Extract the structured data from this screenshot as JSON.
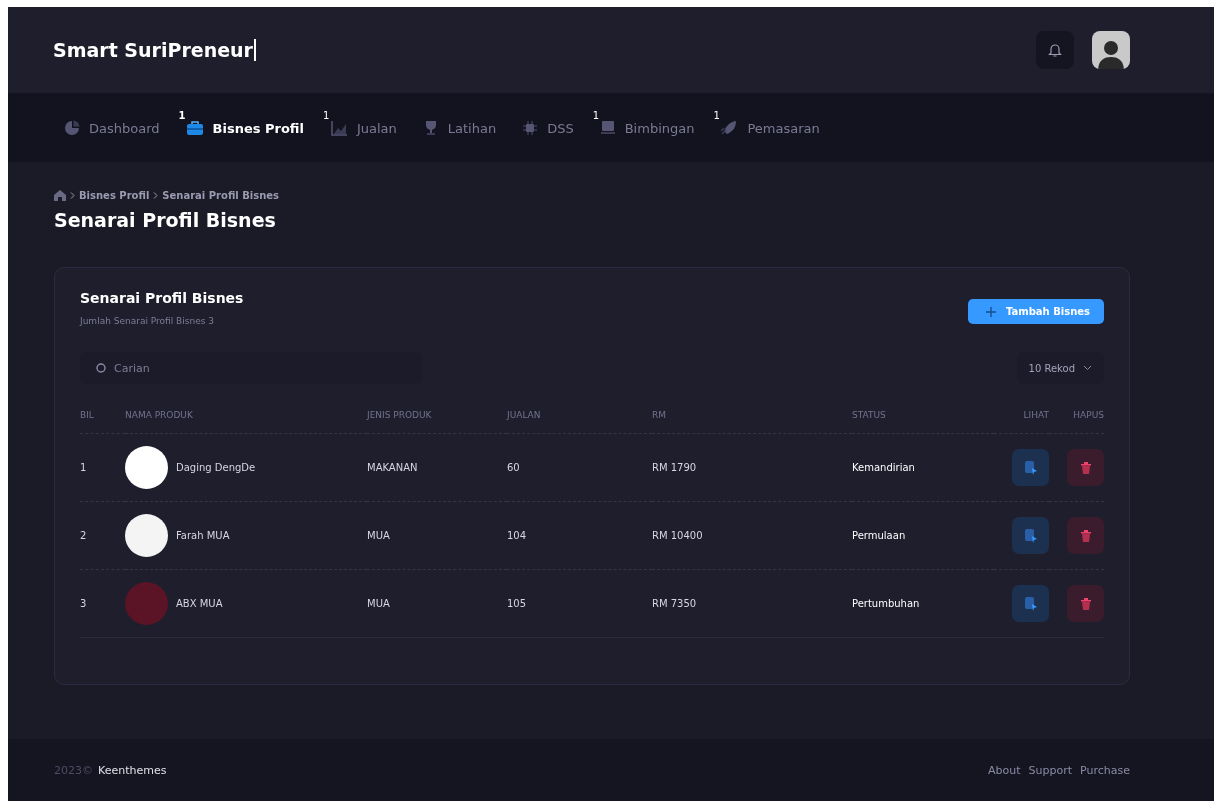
{
  "header": {
    "title": "Smart SuriPreneur"
  },
  "nav": [
    {
      "label": "Dashboard",
      "selected": false
    },
    {
      "label": "Bisnes Profil",
      "badge": "1",
      "selected": true
    },
    {
      "label": "Jualan",
      "badge": "1",
      "selected": false
    },
    {
      "label": "Latihan",
      "selected": false
    },
    {
      "label": "DSS",
      "selected": false
    },
    {
      "label": "Bimbingan",
      "badge": "1",
      "selected": false
    },
    {
      "label": "Pemasaran",
      "badge": "1",
      "selected": false
    }
  ],
  "breadcrumb": [
    "Bisnes Profil",
    "Senarai Profil Bisnes"
  ],
  "page_title": "Senarai Profil Bisnes",
  "card": {
    "title": "Senarai Profil Bisnes",
    "subtitle": "Jumlah Senarai Profil Bisnes 3",
    "add_button": "Tambah Bisnes",
    "search": {
      "placeholder": "Carian"
    },
    "page_size": "10 Rekod",
    "columns": [
      "BIL",
      "NAMA PRODUK",
      "JENIS PRODUK",
      "JUALAN",
      "RM",
      "STATUS",
      "LIHAT",
      "HAPUS"
    ],
    "rows": [
      {
        "no": "1",
        "name": "Daging DengDe",
        "type": "MAKANAN",
        "sales": "60",
        "rm": "RM 1790",
        "status": "Kemandirian"
      },
      {
        "no": "2",
        "name": "Farah MUA",
        "type": "MUA",
        "sales": "104",
        "rm": "RM 10400",
        "status": "Permulaan"
      },
      {
        "no": "3",
        "name": "ABX MUA",
        "type": "MUA",
        "sales": "105",
        "rm": "RM 7350",
        "status": "Pertumbuhan"
      }
    ]
  },
  "footer": {
    "year": "2023©",
    "brand": "Keenthemes",
    "links": [
      "About",
      "Support",
      "Purchase"
    ]
  }
}
